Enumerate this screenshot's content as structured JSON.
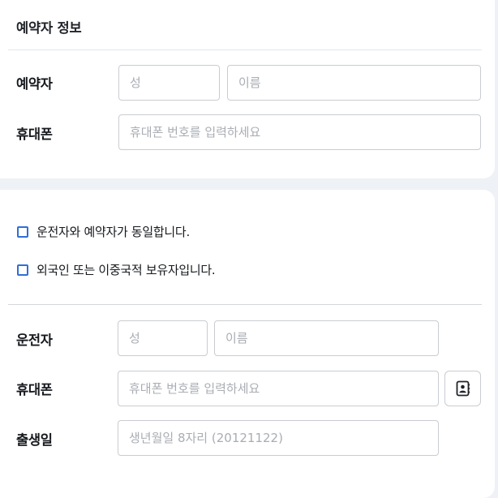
{
  "booker_section": {
    "title": "예약자 정보",
    "name_label": "예약자",
    "last_name": {
      "placeholder": "성",
      "value": ""
    },
    "first_name": {
      "placeholder": "이름",
      "value": ""
    },
    "phone_label": "휴대폰",
    "phone": {
      "placeholder": "휴대폰 번호를 입력하세요",
      "value": ""
    }
  },
  "options": {
    "same_driver": {
      "label": "운전자와 예약자가 동일합니다.",
      "checked": false
    },
    "foreigner": {
      "label": "외국인 또는 이중국적 보유자입니다.",
      "checked": false
    }
  },
  "driver_section": {
    "name_label": "운전자",
    "last_name": {
      "placeholder": "성",
      "value": ""
    },
    "first_name": {
      "placeholder": "이름",
      "value": ""
    },
    "phone_label": "휴대폰",
    "phone": {
      "placeholder": "휴대폰 번호를 입력하세요",
      "value": ""
    },
    "contact_icon": "contact-book-icon",
    "birth_label": "출생일",
    "birth": {
      "placeholder": "생년월일 8자리 (20121122)",
      "value": ""
    }
  },
  "colors": {
    "background": "#eef1f5",
    "card": "#ffffff",
    "checkbox_border": "#2f6fd6",
    "field_border": "#c9ccd1",
    "placeholder": "#a9adb3"
  }
}
